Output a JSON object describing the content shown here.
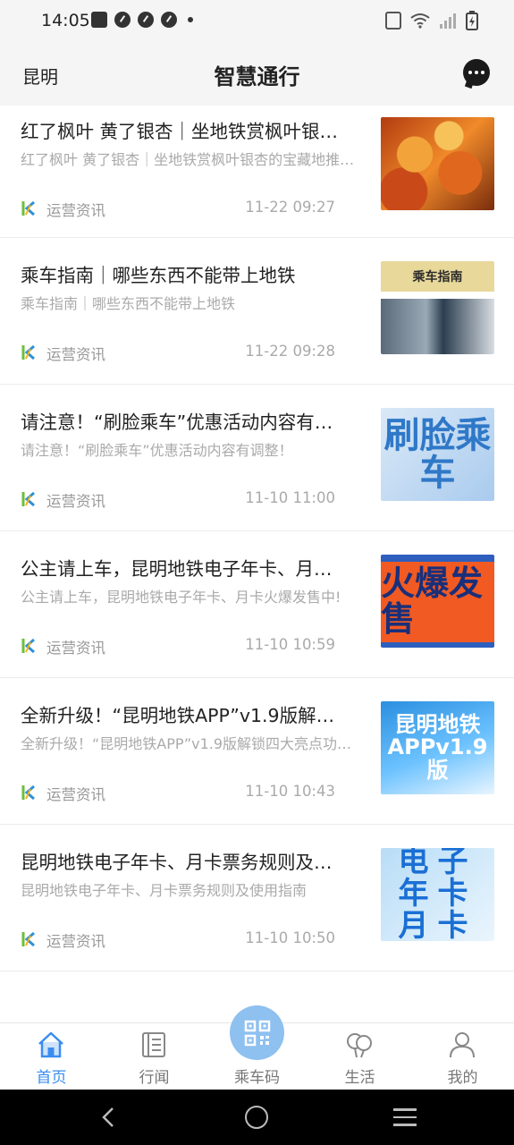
{
  "status_bar": {
    "time": "14:05"
  },
  "header": {
    "city": "昆明",
    "title": "智慧通行"
  },
  "news": [
    {
      "title": "红了枫叶 黄了银杏｜坐地铁赏枫叶银…",
      "summary": "红了枫叶 黄了银杏｜坐地铁赏枫叶银杏的宝藏地推…",
      "source": "运营资讯",
      "time": "11-22 09:27",
      "thumb": "autumn-leaves"
    },
    {
      "title": "乘车指南｜哪些东西不能带上地铁",
      "summary": "乘车指南｜哪些东西不能带上地铁",
      "source": "运营资讯",
      "time": "11-22 09:28",
      "thumb": "riding-guide",
      "thumb_text": "乘车指南"
    },
    {
      "title": "请注意！“刷脸乘车”优惠活动内容有…",
      "summary": "请注意！“刷脸乘车”优惠活动内容有调整！",
      "source": "运营资讯",
      "time": "11-10 11:00",
      "thumb": "face-ride",
      "thumb_text": "刷脸乘车"
    },
    {
      "title": "公主请上车，昆明地铁电子年卡、月…",
      "summary": "公主请上车，昆明地铁电子年卡、月卡火爆发售中!",
      "source": "运营资讯",
      "time": "11-10 10:59",
      "thumb": "hot-sale",
      "thumb_text": "火爆发售"
    },
    {
      "title": "全新升级！“昆明地铁APP”v1.9版解…",
      "summary": "全新升级！“昆明地铁APP”v1.9版解锁四大亮点功…",
      "source": "运营资讯",
      "time": "11-10 10:43",
      "thumb": "app-upgrade",
      "thumb_text": "昆明地铁APPv1.9版"
    },
    {
      "title": "昆明地铁电子年卡、月卡票务规则及…",
      "summary": "昆明地铁电子年卡、月卡票务规则及使用指南",
      "source": "运营资讯",
      "time": "11-10 10:50",
      "thumb": "e-card",
      "thumb_text": "电子年卡月卡"
    }
  ],
  "bottom_nav": [
    {
      "label": "首页",
      "icon": "home-icon",
      "active": true
    },
    {
      "label": "行闻",
      "icon": "news-icon",
      "active": false
    },
    {
      "label": "乘车码",
      "icon": "qr-code-icon",
      "active": false
    },
    {
      "label": "生活",
      "icon": "balloon-icon",
      "active": false
    },
    {
      "label": "我的",
      "icon": "person-icon",
      "active": false
    }
  ],
  "colors": {
    "accent": "#3a8df0",
    "qr_button": "#8ec0f0",
    "hot_sale_bg": "#f15a22"
  }
}
